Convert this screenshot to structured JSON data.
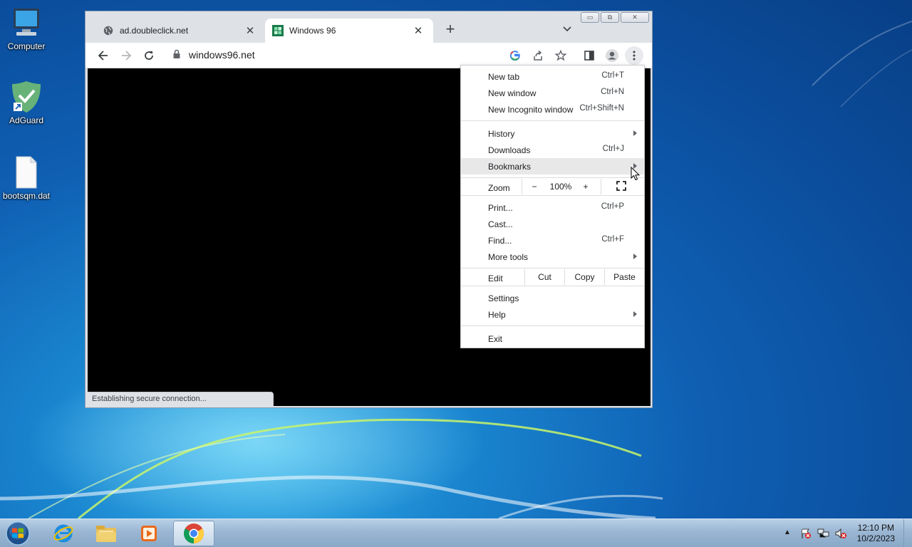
{
  "desktop": {
    "icons": [
      {
        "label": "Computer",
        "icon": "computer-icon"
      },
      {
        "label": "AdGuard",
        "icon": "adguard-shield-icon"
      },
      {
        "label": "bootsqm.dat",
        "icon": "file-icon"
      }
    ]
  },
  "browser": {
    "tabs": [
      {
        "title": "ad.doubleclick.net",
        "icon": "globe-icon",
        "active": false
      },
      {
        "title": "Windows 96",
        "icon": "windows96-favicon",
        "active": true
      }
    ],
    "address": "windows96.net",
    "status_text": "Establishing secure connection..."
  },
  "menu": {
    "items": [
      {
        "label": "New tab",
        "shortcut": "Ctrl+T"
      },
      {
        "label": "New window",
        "shortcut": "Ctrl+N"
      },
      {
        "label": "New Incognito window",
        "shortcut": "Ctrl+Shift+N"
      },
      {
        "label": "History",
        "shortcut": ""
      },
      {
        "label": "Downloads",
        "shortcut": "Ctrl+J"
      },
      {
        "label": "Bookmarks",
        "shortcut": ""
      },
      {
        "label": "Print...",
        "shortcut": "Ctrl+P"
      },
      {
        "label": "Cast...",
        "shortcut": ""
      },
      {
        "label": "Find...",
        "shortcut": "Ctrl+F"
      },
      {
        "label": "More tools",
        "shortcut": ""
      },
      {
        "label": "Settings",
        "shortcut": ""
      },
      {
        "label": "Help",
        "shortcut": ""
      },
      {
        "label": "Exit",
        "shortcut": ""
      }
    ],
    "zoom": {
      "label": "Zoom",
      "minus": "−",
      "value": "100%",
      "plus": "+"
    },
    "edit": {
      "label": "Edit",
      "cut": "Cut",
      "copy": "Copy",
      "paste": "Paste"
    },
    "highlighted": "Bookmarks"
  },
  "taskbar": {
    "time": "12:10 PM",
    "date": "10/2/2023",
    "items": [
      "start-orb-icon",
      "internet-explorer-icon",
      "file-explorer-icon",
      "media-player-icon",
      "chrome-icon"
    ],
    "active": "chrome-icon"
  },
  "colors": {
    "accent": "#1a73e8",
    "desktop": "#0f5fb3",
    "menu_highlight": "#e8e8e9"
  }
}
